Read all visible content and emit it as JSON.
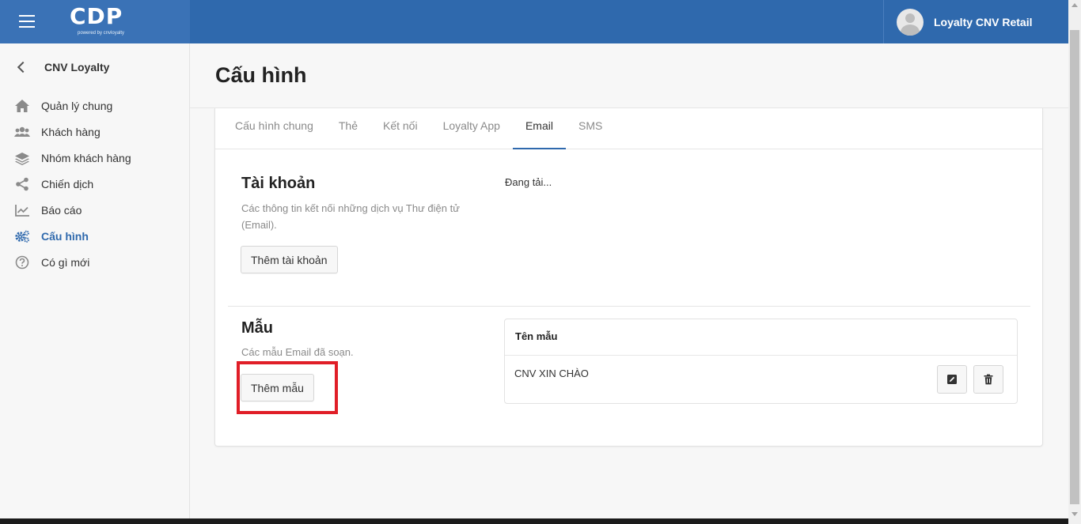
{
  "header": {
    "logo_text": "CDP",
    "logo_sub": "powered by cnvloyalty",
    "user_name": "Loyalty CNV Retail",
    "brand_color": "#2f69ad"
  },
  "sidebar": {
    "back_label": "CNV Loyalty",
    "items": [
      {
        "label": "Quản lý chung",
        "icon": "home-icon"
      },
      {
        "label": "Khách hàng",
        "icon": "users-icon"
      },
      {
        "label": "Nhóm khách hàng",
        "icon": "layers-icon"
      },
      {
        "label": "Chiến dịch",
        "icon": "share-icon"
      },
      {
        "label": "Báo cáo",
        "icon": "chart-icon"
      },
      {
        "label": "Cấu hình",
        "icon": "gears-icon",
        "active": true
      },
      {
        "label": "Có gì mới",
        "icon": "question-icon"
      }
    ]
  },
  "page": {
    "title": "Cấu hình"
  },
  "tabs": [
    "Cấu hình chung",
    "Thẻ",
    "Kết nối",
    "Loyalty App",
    "Email",
    "SMS"
  ],
  "active_tab": "Email",
  "account_section": {
    "title": "Tài khoản",
    "description": "Các thông tin kết nối những dịch vụ Thư điện tử (Email).",
    "add_button": "Thêm tài khoản",
    "loading_text": "Đang tải..."
  },
  "template_section": {
    "title": "Mẫu",
    "description": "Các mẫu Email đã soạn.",
    "add_button": "Thêm mẫu",
    "table_header": "Tên mẫu",
    "rows": [
      {
        "name": "CNV XIN CHÀO"
      }
    ]
  }
}
